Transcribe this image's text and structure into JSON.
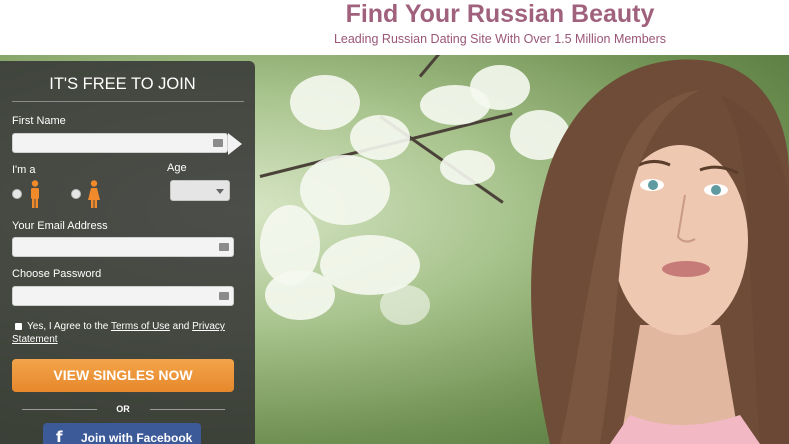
{
  "header": {
    "title": "Find Your Russian Beauty",
    "subtitle": "Leading Russian Dating Site With Over 1.5 Million Members"
  },
  "form": {
    "title": "IT'S FREE TO JOIN",
    "first_name_label": "First Name",
    "first_name_value": "",
    "im_a_label": "I'm a",
    "age_label": "Age",
    "age_value": "",
    "email_label": "Your Email Address",
    "email_value": "",
    "password_label": "Choose Password",
    "password_value": "",
    "agree_text": "Yes, I Agree to the ",
    "terms_link": "Terms of Use",
    "and_text": " and ",
    "privacy_link": "Privacy Statement",
    "submit_label": "VIEW SINGLES NOW",
    "or_label": "OR",
    "facebook_label": "Join with Facebook",
    "facebook_icon": "f"
  },
  "colors": {
    "accent_title": "#a0617d",
    "button_orange": "#ec922f",
    "facebook_blue": "#3d5a98",
    "panel_bg": "#343434"
  }
}
